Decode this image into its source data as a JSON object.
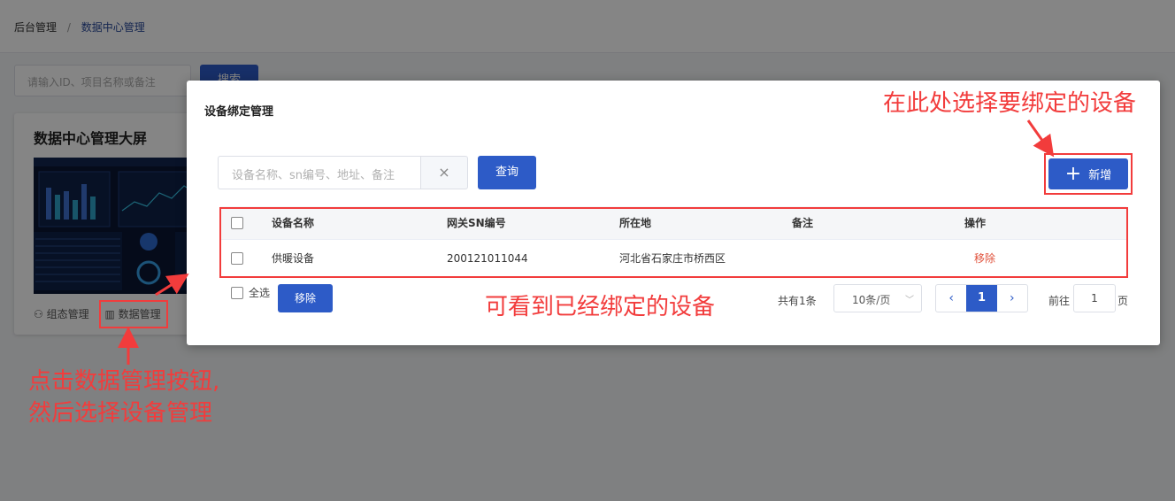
{
  "breadcrumb": {
    "home": "后台管理",
    "separator": "/",
    "current": "数据中心管理"
  },
  "background": {
    "search_placeholder": "请输入ID、项目名称或备注",
    "search_button": "搜索",
    "card": {
      "title": "数据中心管理大屏",
      "actions": [
        "组态管理",
        "数据管理"
      ]
    }
  },
  "dialog": {
    "title": "设备绑定管理",
    "search_placeholder": "设备名称、sn编号、地址、备注",
    "clear_icon": "×",
    "query_button": "查询",
    "add_button": "新增",
    "table": {
      "columns": [
        "设备名称",
        "网关SN编号",
        "所在地",
        "备注",
        "操作"
      ],
      "rows": [
        {
          "name": "供暖设备",
          "sn": "200121011044",
          "location": "河北省石家庄市桥西区",
          "remark": "",
          "action": "移除"
        }
      ]
    },
    "footer": {
      "select_all": "全选",
      "remove_button": "移除",
      "total": "共有1条",
      "page_size": "10条/页",
      "current_page": "1",
      "goto_label": "前往",
      "goto_value": "1",
      "goto_unit": "页"
    }
  },
  "annotations": {
    "top_right": "在此处选择要绑定的设备",
    "middle": "可看到已经绑定的设备",
    "bottom_left_line1": "点击数据管理按钮,",
    "bottom_left_line2": "然后选择设备管理"
  },
  "colors": {
    "primary": "#2d5bc7",
    "annotation": "#f23c3c",
    "danger_link": "#e0513b"
  }
}
